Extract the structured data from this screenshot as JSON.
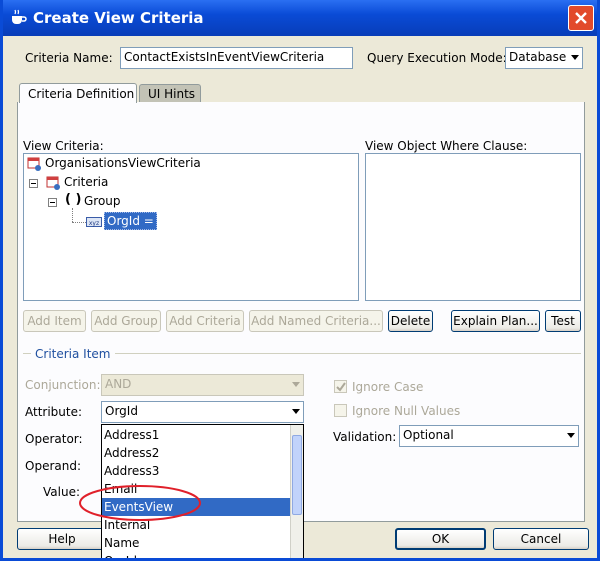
{
  "window": {
    "title": "Create View Criteria"
  },
  "header": {
    "criteria_name_label": "Criteria Name:",
    "criteria_name_value": "ContactExistsInEventViewCriteria",
    "query_mode_label": "Query Execution Mode:",
    "query_mode_value": "Database"
  },
  "tabs": [
    {
      "label": "Criteria Definition",
      "active": true
    },
    {
      "label": "UI Hints",
      "active": false
    }
  ],
  "view_criteria": {
    "label": "View Criteria:",
    "tree": [
      {
        "label": "OrganisationsViewCriteria",
        "icon": "view-criteria-icon",
        "depth": 0
      },
      {
        "label": "Criteria",
        "icon": "criteria-icon",
        "depth": 1
      },
      {
        "label": "Group",
        "icon": "group-parens-icon",
        "depth": 2
      },
      {
        "label": "OrgId =",
        "icon": "attribute-xyz-icon",
        "depth": 3,
        "selected": true
      }
    ]
  },
  "where_clause": {
    "label": "View Object Where Clause:"
  },
  "buttons": {
    "add_item": "Add Item",
    "add_group": "Add Group",
    "add_criteria": "Add Criteria",
    "add_named_criteria": "Add Named Criteria...",
    "delete": "Delete",
    "explain_plan": "Explain Plan...",
    "test": "Test",
    "help": "Help",
    "ok": "OK",
    "cancel": "Cancel"
  },
  "criteria_item": {
    "section_label": "Criteria Item",
    "conjunction_label": "Conjunction:",
    "conjunction_value": "AND",
    "attribute_label": "Attribute:",
    "attribute_value": "OrgId",
    "operator_label": "Operator:",
    "operand_label": "Operand:",
    "value_label": "Value:",
    "ignore_case_label": "Ignore Case",
    "ignore_case_checked": true,
    "ignore_null_label": "Ignore Null Values",
    "ignore_null_checked": false,
    "validation_label": "Validation:",
    "validation_value": "Optional"
  },
  "attribute_options": [
    {
      "label": "Address1"
    },
    {
      "label": "Address2"
    },
    {
      "label": "Address3"
    },
    {
      "label": "Email"
    },
    {
      "label": "EventsView",
      "selected": true
    },
    {
      "label": "Internal"
    },
    {
      "label": "Name"
    },
    {
      "label": "OrgId"
    }
  ],
  "colors": {
    "title_bar": "#0a4bd6",
    "selection": "#316ac5",
    "annotation": "#e0202a",
    "dialog_bg": "#ece9d8"
  }
}
